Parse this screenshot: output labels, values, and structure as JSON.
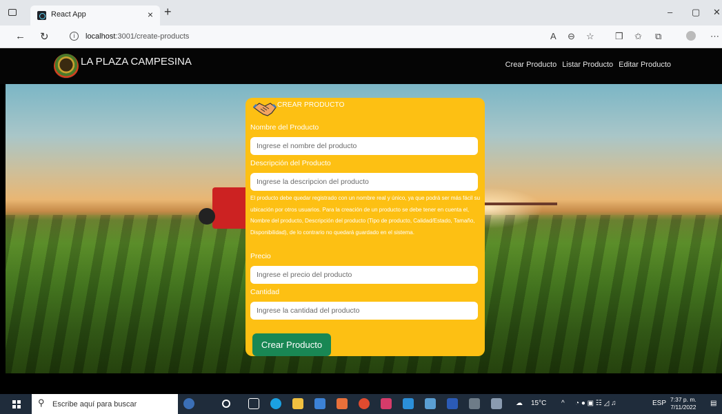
{
  "browser": {
    "tab_title": "React App",
    "tab_close": "×",
    "new_tab": "+",
    "url_host": "localhost",
    "url_path": ":3001/create-products",
    "window_controls": [
      "–",
      "▢",
      "✕"
    ]
  },
  "app": {
    "brand": "LA PLAZA CAMPESINA",
    "nav": [
      {
        "label": "Crear Producto"
      },
      {
        "label": "Listar Producto"
      },
      {
        "label": "Editar Producto"
      }
    ]
  },
  "form": {
    "title": "CREAR PRODUCTO",
    "fields": {
      "name": {
        "label": "Nombre del Producto",
        "placeholder": "Ingrese el nombre del producto"
      },
      "description": {
        "label": "Descripción del Producto",
        "placeholder": "Ingrese la descripcion del producto"
      },
      "price": {
        "label": "Precio",
        "placeholder": "Ingrese el precio del producto"
      },
      "quantity": {
        "label": "Cantidad",
        "placeholder": "Ingrese la cantidad del producto"
      }
    },
    "help_text": "El producto debe quedar registrado con un nombre real y único, ya que podrá ser más fácil su ubicación por otros usuarios. Para la creación de un producto se debe tener en cuenta el, Nombre del producto, Descripción del producto (Tipo de producto, Calidad/Estado, Tamaño, Disponibilidad), de lo contrario no quedará guardado en el sistema.",
    "submit_label": "Crear Producto"
  },
  "taskbar": {
    "search_placeholder": "Escribe aquí para buscar",
    "weather": "15°C",
    "language": "ESP",
    "time": "7:37 p. m.",
    "date": "7/11/2022"
  },
  "colors": {
    "card": "#fdc013",
    "button": "#198754",
    "navbar": "#050505"
  }
}
